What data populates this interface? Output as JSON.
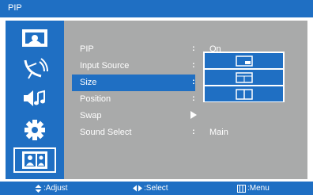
{
  "title": "PIP",
  "colors": {
    "accent": "#1f6fc3",
    "panel": "#a9aaaa",
    "text": "#ffffff"
  },
  "sidebar": {
    "icons": [
      "picture-icon",
      "satellite-dish-icon",
      "sound-icon",
      "gear-icon",
      "pip-icon"
    ],
    "selected_index": 4
  },
  "menu": {
    "items": [
      {
        "label": "PIP",
        "value": "On"
      },
      {
        "label": "Input Source",
        "value": ""
      },
      {
        "label": "Size",
        "value": ""
      },
      {
        "label": "Position",
        "value": ""
      },
      {
        "label": "Swap",
        "value": ""
      },
      {
        "label": "Sound Select",
        "value": "Main"
      }
    ],
    "selected_index": 2
  },
  "size_options": [
    "pip-small-window-icon",
    "pip-split-unequal-icon",
    "pip-split-equal-icon"
  ],
  "footer": {
    "adjust": ":Adjust",
    "select": ":Select",
    "menu": ":Menu"
  }
}
